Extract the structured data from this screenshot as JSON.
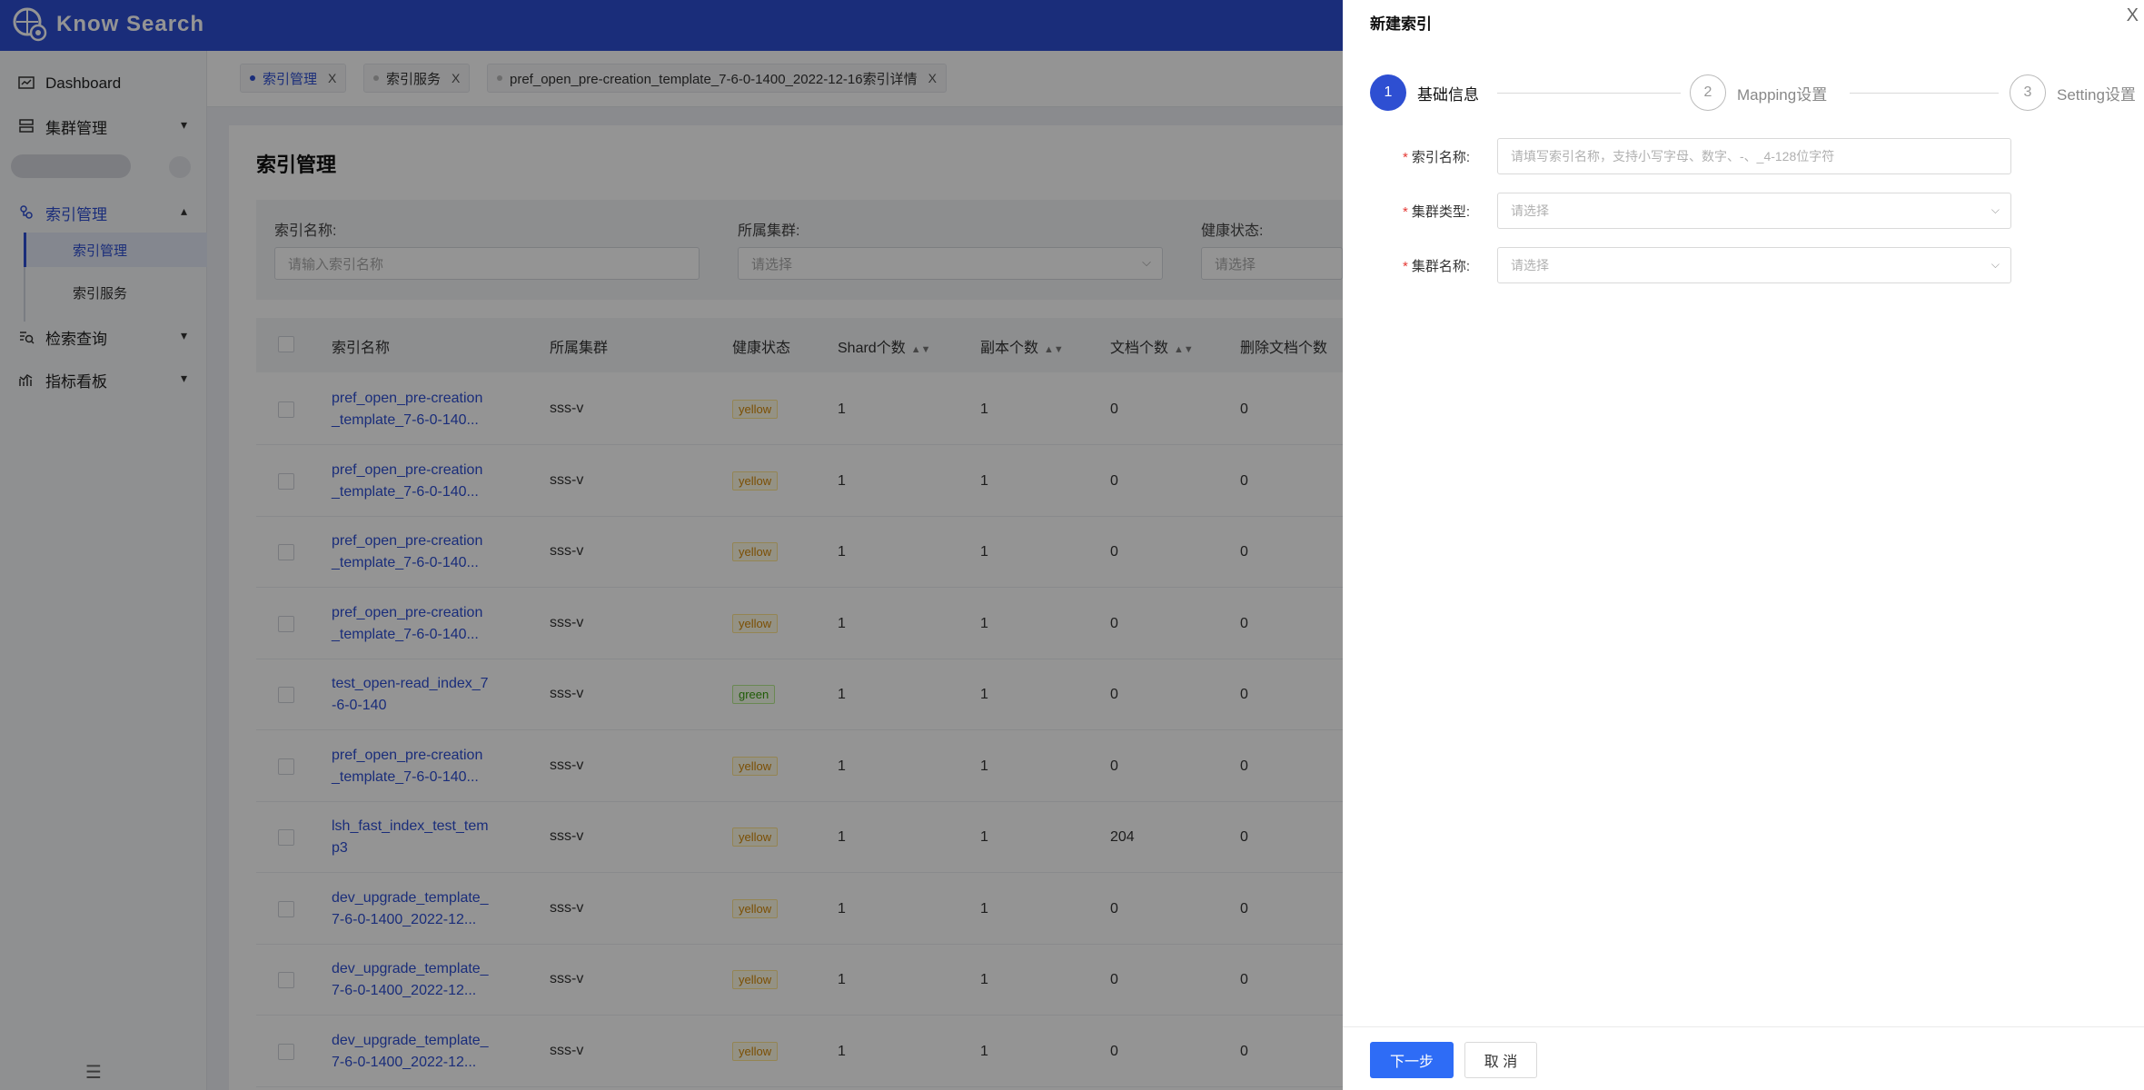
{
  "app": {
    "title": "Know Search"
  },
  "sidebar": {
    "items": [
      {
        "label": "Dashboard",
        "icon": "dashboard-icon"
      },
      {
        "label": "集群管理",
        "icon": "cluster-icon"
      },
      {
        "label": "索引管理",
        "icon": "index-icon"
      },
      {
        "label": "检索查询",
        "icon": "search-query-icon"
      },
      {
        "label": "指标看板",
        "icon": "metrics-icon"
      }
    ],
    "sub_items": [
      {
        "label": "索引管理",
        "active": true
      },
      {
        "label": "索引服务",
        "active": false
      }
    ]
  },
  "tabs": [
    {
      "label": "索引管理",
      "active": true,
      "close": "X"
    },
    {
      "label": "索引服务",
      "active": false,
      "close": "X"
    },
    {
      "label": "pref_open_pre-creation_template_7-6-0-1400_2022-12-16索引详情",
      "active": false,
      "close": "X"
    }
  ],
  "main": {
    "title": "索引管理",
    "filters": [
      {
        "label": "索引名称:",
        "placeholder": "请输入索引名称"
      },
      {
        "label": "所属集群:",
        "placeholder": "请选择"
      },
      {
        "label": "健康状态:",
        "placeholder": "请选择"
      }
    ],
    "table": {
      "headers": [
        "索引名称",
        "所属集群",
        "健康状态",
        "Shard个数",
        "副本个数",
        "文档个数",
        "删除文档个数"
      ],
      "rows": [
        {
          "name1": "pref_open_pre-creation",
          "name2": "_template_7-6-0-140...",
          "cluster": "sss-v",
          "health": "yellow",
          "shard": "1",
          "replica": "1",
          "docs": "0",
          "deleted": "0"
        },
        {
          "name1": "pref_open_pre-creation",
          "name2": "_template_7-6-0-140...",
          "cluster": "sss-v",
          "health": "yellow",
          "shard": "1",
          "replica": "1",
          "docs": "0",
          "deleted": "0"
        },
        {
          "name1": "pref_open_pre-creation",
          "name2": "_template_7-6-0-140...",
          "cluster": "sss-v",
          "health": "yellow",
          "shard": "1",
          "replica": "1",
          "docs": "0",
          "deleted": "0"
        },
        {
          "name1": "pref_open_pre-creation",
          "name2": "_template_7-6-0-140...",
          "cluster": "sss-v",
          "health": "yellow",
          "shard": "1",
          "replica": "1",
          "docs": "0",
          "deleted": "0"
        },
        {
          "name1": "test_open-read_index_7",
          "name2": "-6-0-140",
          "cluster": "sss-v",
          "health": "green",
          "shard": "1",
          "replica": "1",
          "docs": "0",
          "deleted": "0"
        },
        {
          "name1": "pref_open_pre-creation",
          "name2": "_template_7-6-0-140...",
          "cluster": "sss-v",
          "health": "yellow",
          "shard": "1",
          "replica": "1",
          "docs": "0",
          "deleted": "0"
        },
        {
          "name1": "lsh_fast_index_test_tem",
          "name2": "p3",
          "cluster": "sss-v",
          "health": "yellow",
          "shard": "1",
          "replica": "1",
          "docs": "204",
          "deleted": "0"
        },
        {
          "name1": "dev_upgrade_template_",
          "name2": "7-6-0-1400_2022-12...",
          "cluster": "sss-v",
          "health": "yellow",
          "shard": "1",
          "replica": "1",
          "docs": "0",
          "deleted": "0"
        },
        {
          "name1": "dev_upgrade_template_",
          "name2": "7-6-0-1400_2022-12...",
          "cluster": "sss-v",
          "health": "yellow",
          "shard": "1",
          "replica": "1",
          "docs": "0",
          "deleted": "0"
        },
        {
          "name1": "dev_upgrade_template_",
          "name2": "7-6-0-1400_2022-12...",
          "cluster": "sss-v",
          "health": "yellow",
          "shard": "1",
          "replica": "1",
          "docs": "0",
          "deleted": "0"
        }
      ]
    }
  },
  "drawer": {
    "title": "新建索引",
    "close": "X",
    "steps": [
      {
        "num": "1",
        "label": "基础信息",
        "active": true
      },
      {
        "num": "2",
        "label": "Mapping设置",
        "active": false
      },
      {
        "num": "3",
        "label": "Setting设置",
        "active": false
      }
    ],
    "fields": [
      {
        "label": "索引名称:",
        "placeholder": "请填写索引名称，支持小写字母、数字、-、_4-128位字符"
      },
      {
        "label": "集群类型:",
        "placeholder": "请选择"
      },
      {
        "label": "集群名称:",
        "placeholder": "请选择"
      }
    ],
    "required_mark": "*",
    "next_label": "下一步",
    "cancel_label": "取 消"
  },
  "colors": {
    "brand": "#2e4fd2",
    "primary_button": "#2e6cf6"
  }
}
